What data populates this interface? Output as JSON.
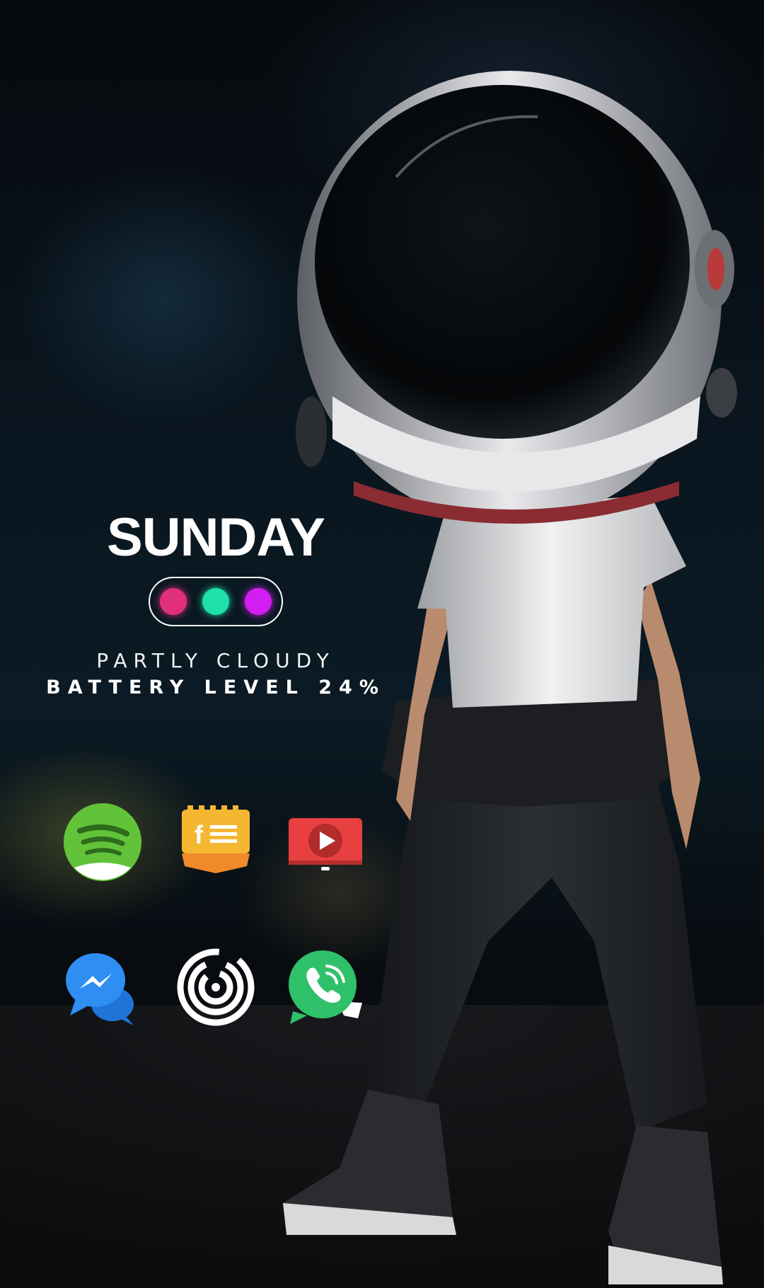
{
  "widget": {
    "day": "SUNDAY",
    "weather": "PARTLY CLOUDY",
    "battery": "BATTERY LEVEL 24%",
    "dot_colors": [
      "#e0307a",
      "#1fe0a8",
      "#d21ef0"
    ]
  },
  "apps": [
    {
      "name": "spotify",
      "icon": "spotify-icon",
      "color": "#62c33b"
    },
    {
      "name": "facebook-news",
      "icon": "facebook-news-icon",
      "color": "#f5b731"
    },
    {
      "name": "youtube",
      "icon": "youtube-tv-icon",
      "color": "#e84040"
    },
    {
      "name": "messenger",
      "icon": "messenger-icon",
      "color": "#2f8ef2"
    },
    {
      "name": "maze-app",
      "icon": "fingerprint-maze-icon",
      "color": "#ffffff"
    },
    {
      "name": "whatsapp",
      "icon": "whatsapp-icon",
      "color": "#2fc06a"
    }
  ],
  "wallpaper": {
    "subject": "astronaut-helmet-kid-icon"
  }
}
